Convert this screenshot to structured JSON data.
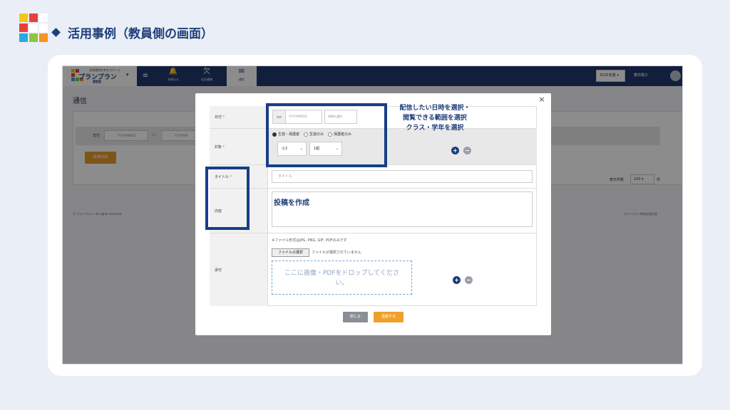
{
  "slide": {
    "title": "活用事例（教員側の画面）",
    "logo_colors": [
      "#f5c518",
      "#e8413c",
      "#ffffff",
      "#e8413c",
      "#ffffff",
      "#ffffff",
      "#2aa7e0",
      "#8cc63f",
      "#f7941d"
    ]
  },
  "app": {
    "brand": {
      "tagline": "学校運営を幸せスクール",
      "name": "プランプラン",
      "sub": "運営版"
    },
    "nav": [
      {
        "icon": "bell-icon",
        "glyph": "🔔",
        "label": "お知らせ"
      },
      {
        "icon": "attendance-icon",
        "glyph": "欠",
        "label": "出欠連絡"
      },
      {
        "icon": "message-icon",
        "glyph": "✉",
        "label": "通信"
      }
    ],
    "year": "2025年度",
    "user": "櫻井陽子",
    "page_title": "通信",
    "filter": {
      "label": "日付",
      "from_placeholder": "YYYY/MM/DD",
      "sep": "―",
      "to_placeholder": "YYYY/MM"
    },
    "new_button": "新規作成",
    "perpage_label": "表示件数",
    "perpage_value": "100",
    "perpage_unit": "件",
    "footer_left": "© プランプラン. All rights reserved",
    "footer_right": "プランプラン特別支援学校"
  },
  "modal": {
    "close": "×",
    "labels": {
      "date": "日付",
      "target": "対象",
      "title": "タイトル",
      "content": "内容",
      "attach": "添付",
      "required": "*"
    },
    "date_placeholder": "YYYY/MM/DD",
    "time_placeholder": "時間を選択",
    "radios": [
      {
        "label": "生徒・保護者",
        "checked": true
      },
      {
        "label": "生徒のみ",
        "checked": false
      },
      {
        "label": "保護者のみ",
        "checked": false
      }
    ],
    "grade": "小2",
    "class": "1組",
    "title_placeholder": "タイトル",
    "content_text": "投稿を作成",
    "file_note": "※ファイル形式はJPG, PNG, GIF, PDFのみです",
    "file_button": "ファイルの選択",
    "file_status": "ファイルが選択されていません",
    "dropzone": "ここに画像・PDFをドロップしてください。",
    "btn_close": "閉じる",
    "btn_submit": "登録する"
  },
  "annotation": {
    "lines": [
      "配信したい日時を選択・",
      "閲覧できる範囲を選択",
      "クラス・学年を選択"
    ],
    "color": "#163f87"
  }
}
